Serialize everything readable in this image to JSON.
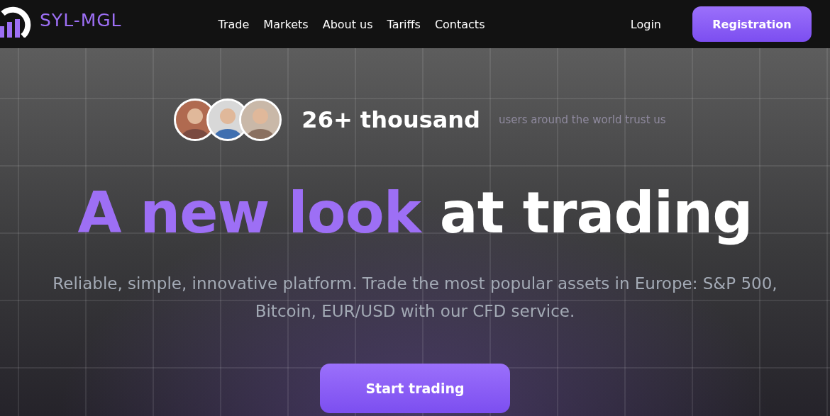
{
  "header": {
    "logo": "SYL-MGL",
    "nav": [
      {
        "label": "Trade"
      },
      {
        "label": "Markets"
      },
      {
        "label": "About us"
      },
      {
        "label": "Tariffs"
      },
      {
        "label": "Contacts"
      }
    ],
    "login": "Login",
    "register": "Registration"
  },
  "hero": {
    "users_count": "26+ thousand",
    "users_caption": "users around the world trust us",
    "headline_accent": "A new look",
    "headline_rest": "at trading",
    "subtitle": "Reliable, simple, innovative platform. Trade the most popular assets in Europe: S&P 500, Bitcoin, EUR/USD with our CFD service.",
    "cta": "Start trading"
  }
}
